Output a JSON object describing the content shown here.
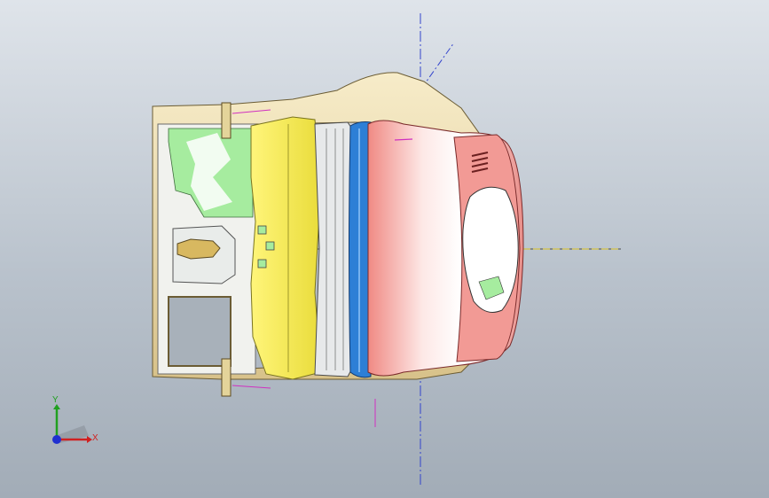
{
  "viewport": {
    "background_top": "#dfe4ea",
    "background_bottom": "#a2acb7"
  },
  "triad": {
    "x_label": "X",
    "y_label": "Y",
    "x_color": "#d02020",
    "y_color": "#20a020",
    "z_color": "#2030d0"
  },
  "model": {
    "colors": {
      "tan": "#e9d7a8",
      "yellow": "#f6f066",
      "green": "#9fe89a",
      "blue": "#2d7fd6",
      "pink": "#f3a9a5",
      "gray": "#cfd3d6"
    }
  }
}
